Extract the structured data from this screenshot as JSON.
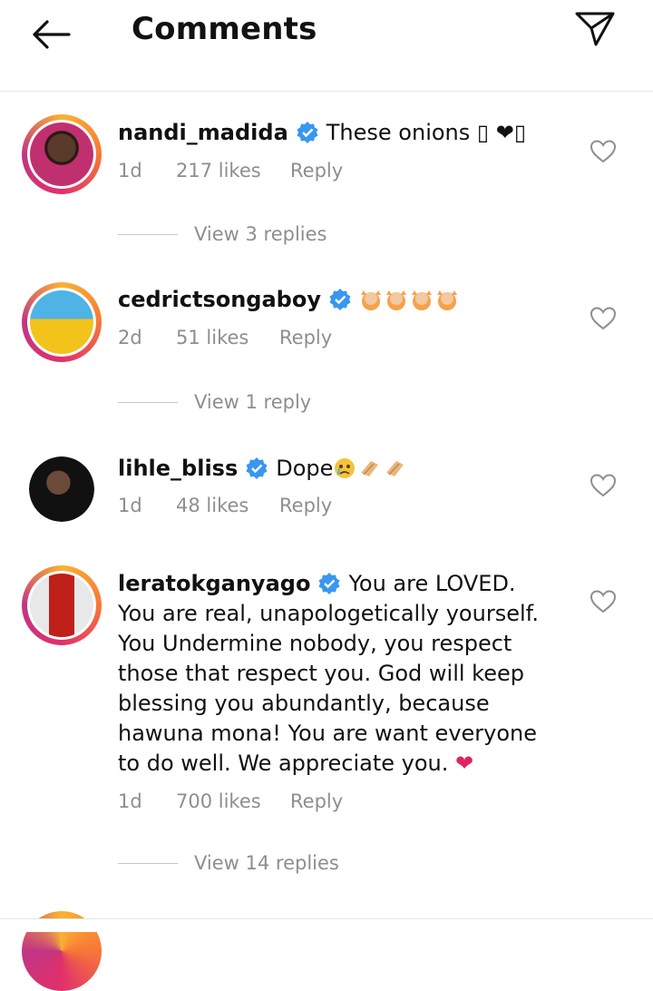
{
  "header": {
    "title": "Comments"
  },
  "comments": [
    {
      "username": "nandi_madida",
      "text": "These onions ▯ ❤▯",
      "time": "1d",
      "likes": "217 likes",
      "reply_label": "Reply",
      "view_replies": "View 3 replies"
    },
    {
      "username": "cedrictsongaboy",
      "text": "",
      "time": "2d",
      "likes": "51 likes",
      "reply_label": "Reply",
      "view_replies": "View 1 reply"
    },
    {
      "username": "lihle_bliss",
      "text": "Dope",
      "time": "1d",
      "likes": "48 likes",
      "reply_label": "Reply"
    },
    {
      "username": "leratokganyago",
      "text": "You are LOVED. You are real, unapologetically yourself. You Undermine nobody, you respect those that respect you. God will keep blessing you abundantly, because hawuna mona! You are want everyone to do well. We appreciate you.",
      "heart": "❤",
      "time": "1d",
      "likes": "700 likes",
      "reply_label": "Reply",
      "view_replies": "View 14 replies"
    }
  ],
  "colors": {
    "verified": "#3897f0",
    "muted": "#8e8e8e",
    "heart": "#e0245e"
  }
}
